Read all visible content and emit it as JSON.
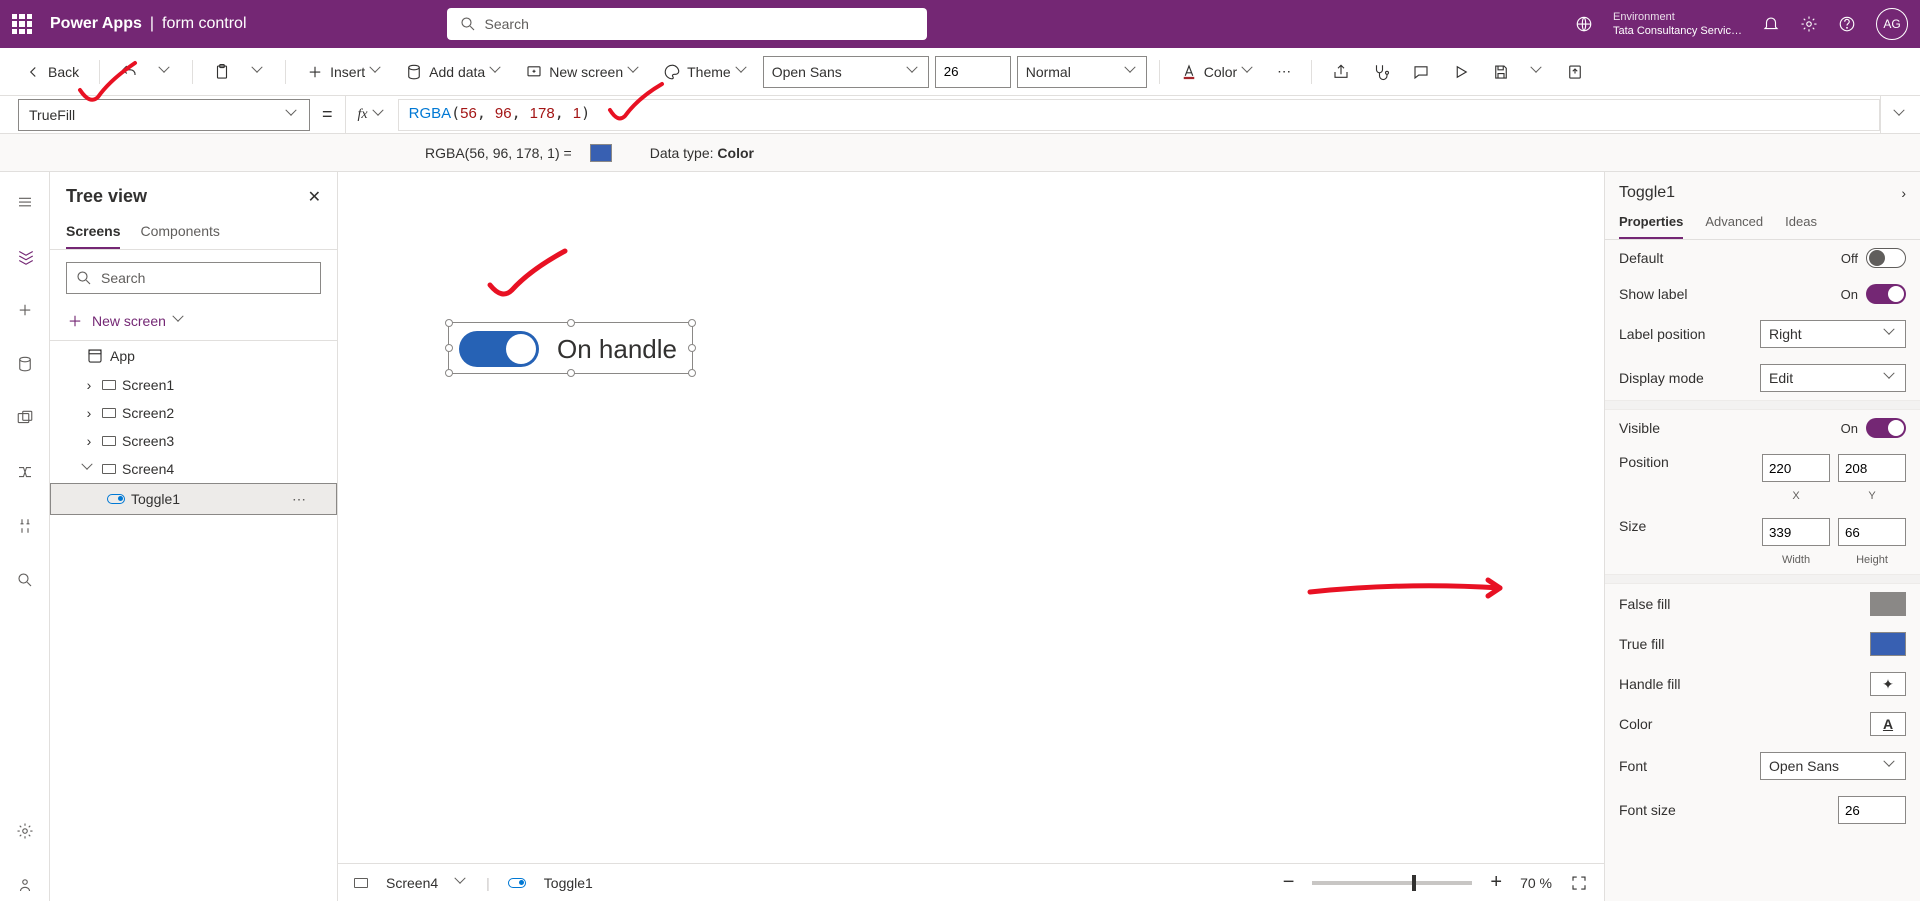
{
  "header": {
    "brand": "Power Apps",
    "doc": "form control",
    "search_placeholder": "Search",
    "env_label": "Environment",
    "env_name": "Tata Consultancy Servic…",
    "avatar": "AG"
  },
  "toolbar": {
    "back": "Back",
    "insert": "Insert",
    "add_data": "Add data",
    "new_screen": "New screen",
    "theme": "Theme",
    "font": "Open Sans",
    "font_size": "26",
    "font_weight": "Normal",
    "color": "Color"
  },
  "formula": {
    "property": "TrueFill",
    "fn": "RGBA",
    "a1": "56",
    "a2": "96",
    "a3": "178",
    "a4": "1",
    "preview": "RGBA(56, 96, 178, 1)  =",
    "datatype_label": "Data type:",
    "datatype": "Color"
  },
  "tree": {
    "title": "Tree view",
    "tab_screens": "Screens",
    "tab_components": "Components",
    "search_placeholder": "Search",
    "new_screen": "New screen",
    "app": "App",
    "screens": [
      "Screen1",
      "Screen2",
      "Screen3",
      "Screen4"
    ],
    "toggle": "Toggle1"
  },
  "canvas": {
    "toggle_label": "On handle"
  },
  "props": {
    "control": "Toggle1",
    "tab_properties": "Properties",
    "tab_advanced": "Advanced",
    "tab_ideas": "Ideas",
    "default_lbl": "Default",
    "default_val": "Off",
    "showlabel_lbl": "Show label",
    "showlabel_val": "On",
    "labelpos_lbl": "Label position",
    "labelpos_val": "Right",
    "dispmode_lbl": "Display mode",
    "dispmode_val": "Edit",
    "visible_lbl": "Visible",
    "visible_val": "On",
    "position_lbl": "Position",
    "pos_x": "220",
    "pos_y": "208",
    "x": "X",
    "y": "Y",
    "size_lbl": "Size",
    "size_w": "339",
    "size_h": "66",
    "w": "Width",
    "h": "Height",
    "falsefill_lbl": "False fill",
    "falsefill": "#8a8886",
    "truefill_lbl": "True fill",
    "truefill": "#3860b2",
    "handlefill_lbl": "Handle fill",
    "color_lbl": "Color",
    "font_lbl": "Font",
    "font_val": "Open Sans",
    "fontsize_lbl": "Font size",
    "fontsize_val": "26"
  },
  "status": {
    "screen": "Screen4",
    "control": "Toggle1",
    "zoom": "70",
    "zoom_pct": "%"
  }
}
